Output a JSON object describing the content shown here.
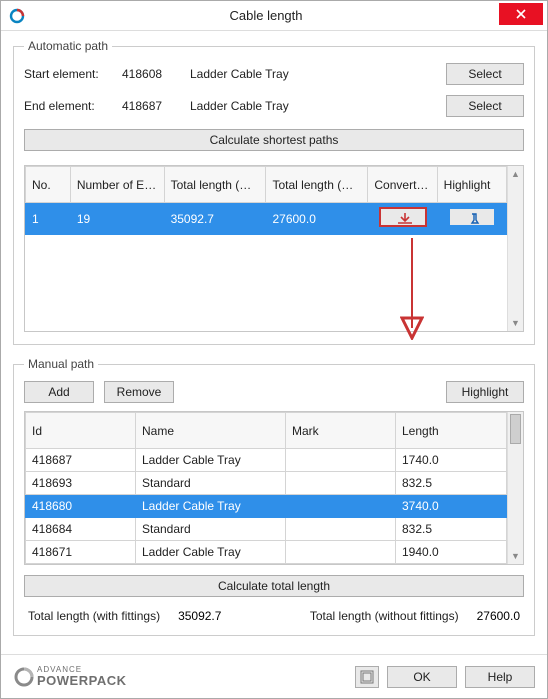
{
  "window": {
    "title": "Cable length"
  },
  "auto": {
    "legend": "Automatic path",
    "start_label": "Start element:",
    "start_id": "418608",
    "start_desc": "Ladder Cable Tray",
    "end_label": "End element:",
    "end_id": "418687",
    "end_desc": "Ladder Cable Tray",
    "select_btn": "Select",
    "calc_btn": "Calculate shortest paths",
    "headers": {
      "no": "No.",
      "num_elem": "Number of Elements",
      "len_with": "Total length (with fittings)",
      "len_without": "Total length (without fittings)",
      "convert": "Convert to manual",
      "highlight": "Highlight"
    },
    "rows": [
      {
        "no": "1",
        "num": "19",
        "with": "35092.7",
        "without": "27600.0"
      }
    ]
  },
  "manual": {
    "legend": "Manual path",
    "add_btn": "Add",
    "remove_btn": "Remove",
    "highlight_btn": "Highlight",
    "headers": {
      "id": "Id",
      "name": "Name",
      "mark": "Mark",
      "length": "Length"
    },
    "rows": [
      {
        "id": "418687",
        "name": "Ladder Cable Tray",
        "mark": "",
        "length": "1740.0",
        "sel": false
      },
      {
        "id": "418693",
        "name": "Standard",
        "mark": "",
        "length": "832.5",
        "sel": false
      },
      {
        "id": "418680",
        "name": "Ladder Cable Tray",
        "mark": "",
        "length": "3740.0",
        "sel": true
      },
      {
        "id": "418684",
        "name": "Standard",
        "mark": "",
        "length": "832.5",
        "sel": false
      },
      {
        "id": "418671",
        "name": "Ladder Cable Tray",
        "mark": "",
        "length": "1940.0",
        "sel": false
      }
    ],
    "calc_total_btn": "Calculate total length",
    "total_with_label": "Total length (with fittings)",
    "total_with_value": "35092.7",
    "total_without_label": "Total length (without fittings)",
    "total_without_value": "27600.0"
  },
  "footer": {
    "brand_small": "ADVANCE",
    "brand_big": "POWERPACK",
    "ok": "OK",
    "help": "Help"
  }
}
